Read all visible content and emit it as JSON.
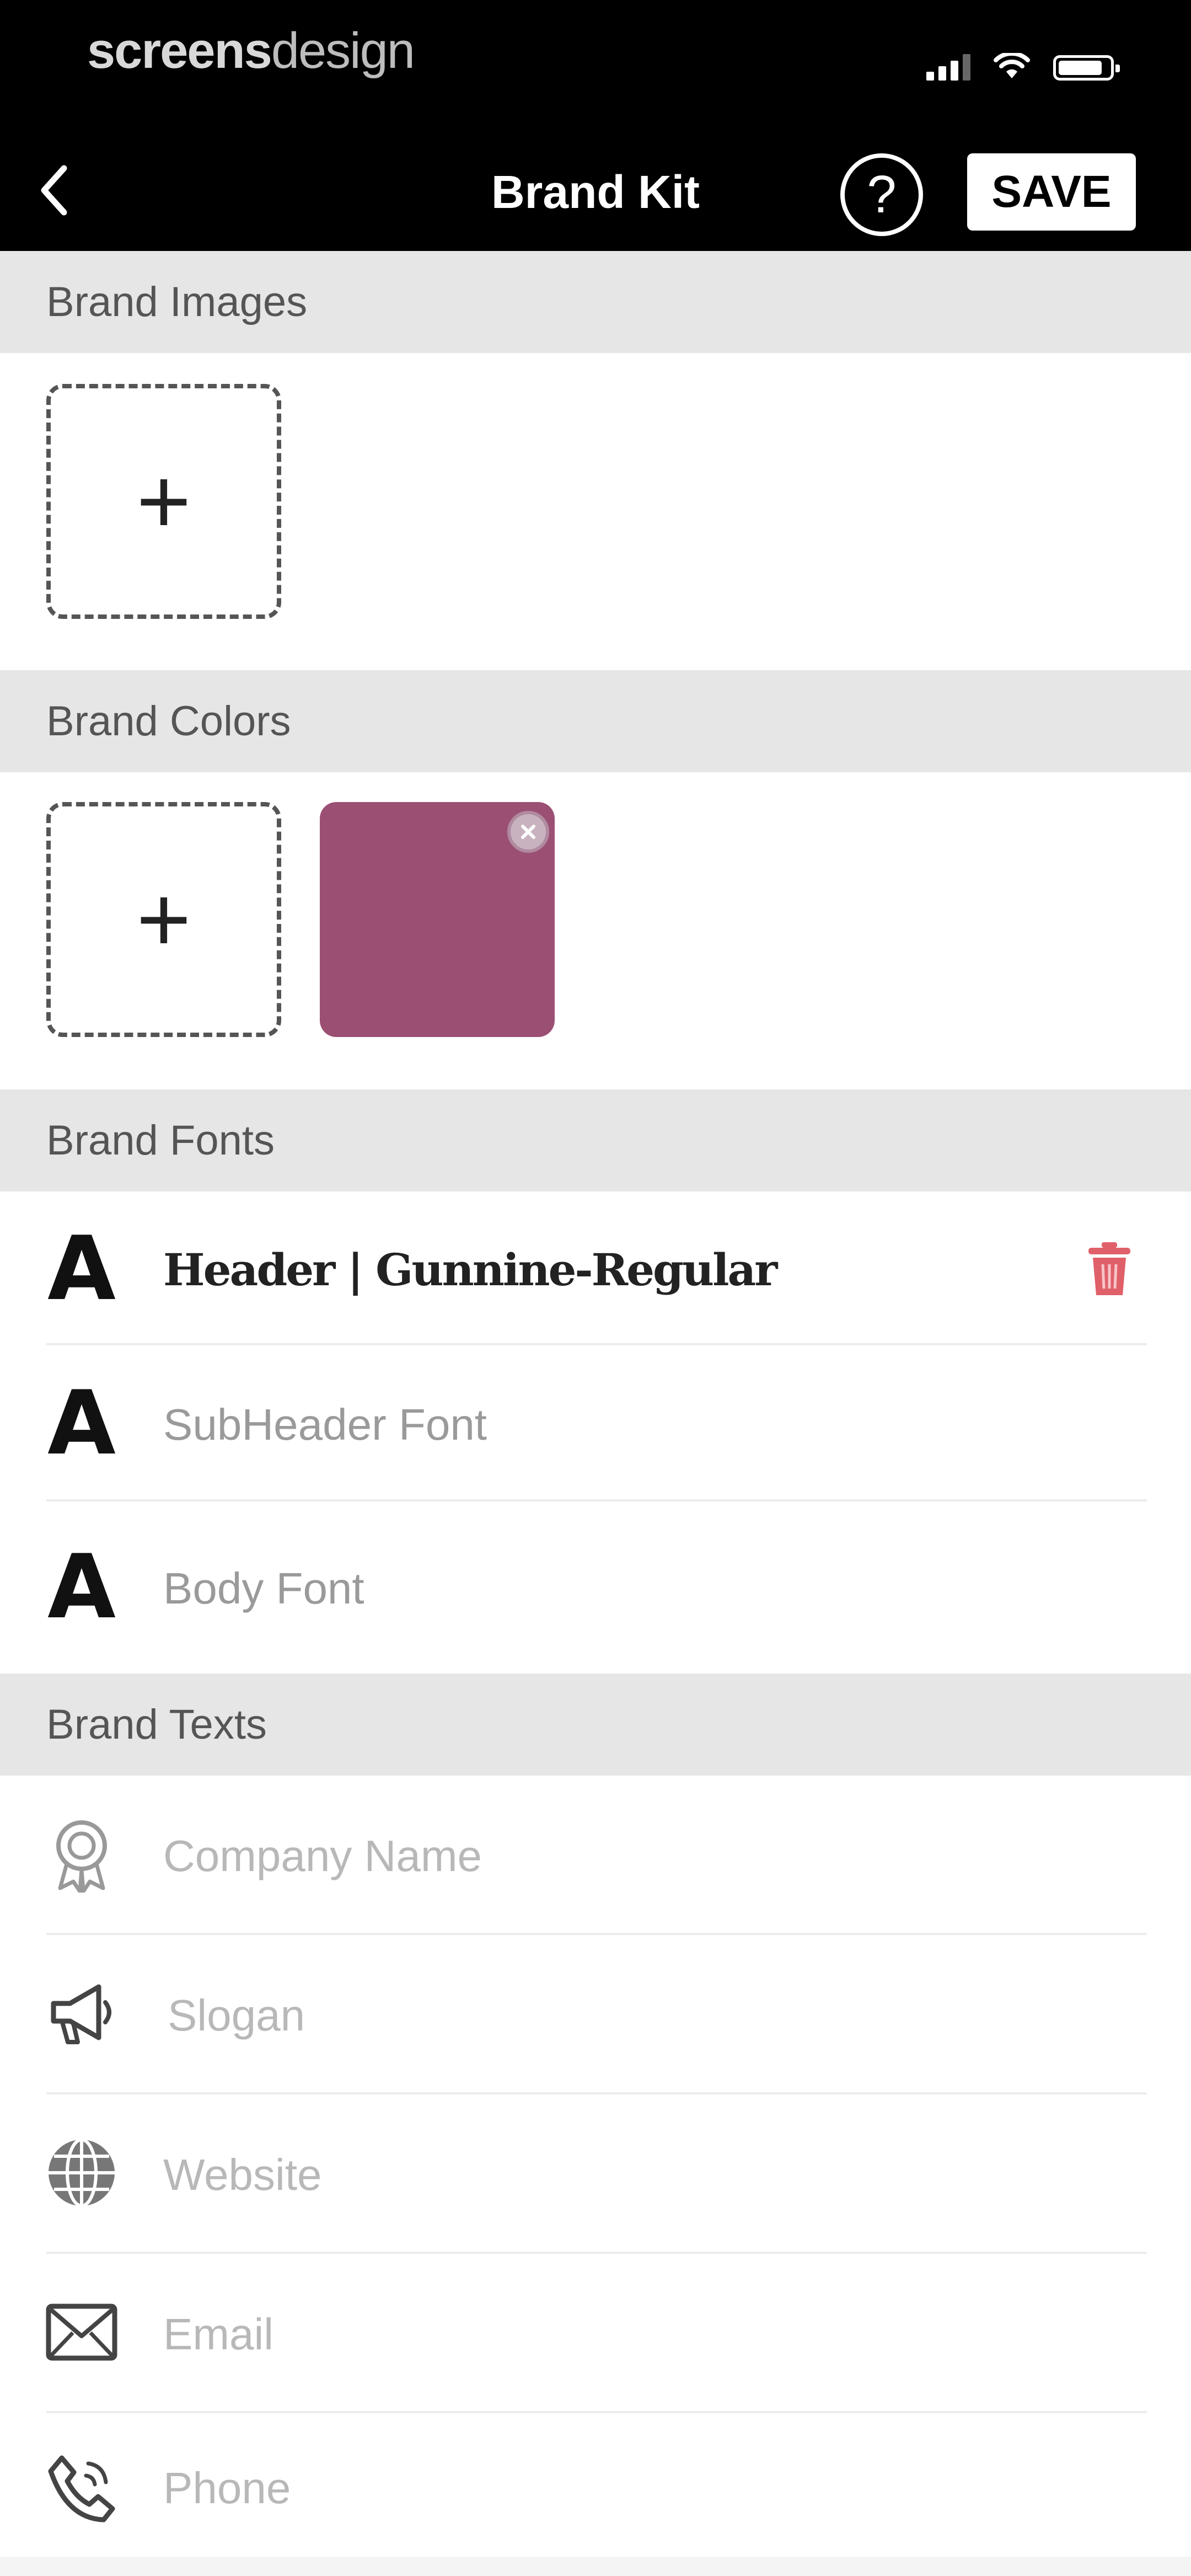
{
  "watermark": {
    "bold": "screens",
    "light": "design"
  },
  "status_bar": {
    "signal_icon": "cellular-signal-icon",
    "wifi_icon": "wifi-icon",
    "battery_icon": "battery-icon"
  },
  "header": {
    "back_icon": "chevron-left-icon",
    "title": "Brand Kit",
    "help_label": "?",
    "save_label": "SAVE"
  },
  "sections": {
    "images": {
      "title": "Brand Images",
      "add_label": "+"
    },
    "colors": {
      "title": "Brand Colors",
      "add_label": "+",
      "swatches": [
        {
          "color": "#9b4f73",
          "remove_icon": "close-circle-icon"
        }
      ]
    },
    "fonts": {
      "title": "Brand Fonts",
      "items": [
        {
          "glyph": "A",
          "label": "Header | Gunnine-Regular",
          "delete_icon": "trash-icon"
        },
        {
          "glyph": "A",
          "label": "SubHeader Font"
        },
        {
          "glyph": "A",
          "label": "Body Font"
        }
      ]
    },
    "texts": {
      "title": "Brand Texts",
      "fields": [
        {
          "icon": "award-ribbon-icon",
          "placeholder": "Company Name"
        },
        {
          "icon": "megaphone-icon",
          "placeholder": "Slogan"
        },
        {
          "icon": "globe-icon",
          "placeholder": "Website"
        },
        {
          "icon": "envelope-icon",
          "placeholder": "Email"
        },
        {
          "icon": "phone-icon",
          "placeholder": "Phone"
        }
      ]
    }
  },
  "colors": {
    "topbar": "#000000",
    "section_header_bg": "#e6e6e6",
    "swatch": "#9b4f73",
    "delete": "#e0606a"
  }
}
